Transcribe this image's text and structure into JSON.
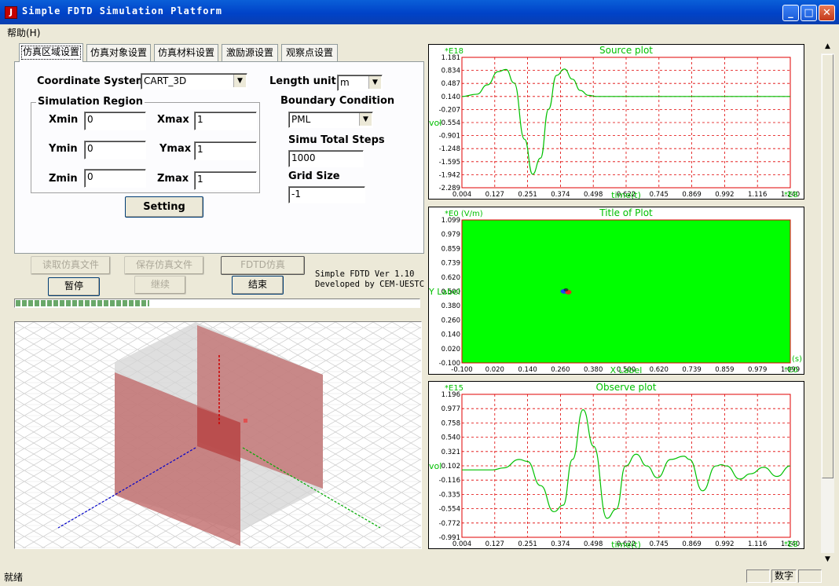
{
  "window": {
    "title": "Simple FDTD Simulation Platform"
  },
  "menu": {
    "help": "帮助(H)"
  },
  "tabs": [
    "仿真区域设置",
    "仿真对象设置",
    "仿真材料设置",
    "激励源设置",
    "观察点设置"
  ],
  "form": {
    "coord_label": "Coordinate  System",
    "coord_value": "CART_3D",
    "length_label": "Length unit",
    "length_value": "m",
    "region_title": "Simulation Region",
    "xmin_label": "Xmin",
    "xmin": "0",
    "xmax_label": "Xmax",
    "xmax": "1",
    "ymin_label": "Ymin",
    "ymin": "0",
    "ymax_label": "Ymax",
    "ymax": "1",
    "zmin_label": "Zmin",
    "zmin": "0",
    "zmax_label": "Zmax",
    "zmax": "1",
    "boundary_label": "Boundary Condition",
    "boundary_value": "PML",
    "steps_label": "Simu Total Steps",
    "steps_value": "1000",
    "grid_label": "Grid Size",
    "grid_value": "-1",
    "setting_button": "Setting"
  },
  "controls": {
    "read_file": "读取仿真文件",
    "save_file": "保存仿真文件",
    "fdtd_sim": "FDTD仿真",
    "pause": "暂停",
    "resume": "继续",
    "end": "结束",
    "version": "Simple FDTD Ver 1.10",
    "developer": "Developed by CEM-UESTC",
    "progress": 0.33
  },
  "colors": {
    "plot_green": "#00c000",
    "grid_red": "#e00000",
    "field_green": "#00ff00",
    "box": "#c06b6b"
  },
  "chart_data": [
    {
      "type": "line",
      "title": "Source plot",
      "multiplier": "*E18",
      "ylabel": "vol",
      "xlabel": "time(t)",
      "x_multiplier": "*E8",
      "ylim": [
        -2.289,
        1.181
      ],
      "yticks": [
        "1.181",
        "0.834",
        "0.487",
        "0.140",
        "-0.207",
        "-0.554",
        "-0.901",
        "-1.248",
        "-1.595",
        "-1.942",
        "-2.289"
      ],
      "xlim": [
        0.004,
        1.24
      ],
      "xticks": [
        "0.004",
        "0.127",
        "0.251",
        "0.374",
        "0.498",
        "0.622",
        "0.745",
        "0.869",
        "0.992",
        "1.116",
        "1.240"
      ],
      "series": [
        {
          "x": [
            0.004,
            0.06,
            0.1,
            0.14,
            0.17,
            0.2,
            0.24,
            0.27,
            0.3,
            0.33,
            0.36,
            0.39,
            0.42,
            0.45,
            0.48,
            0.51,
            0.56,
            0.62,
            0.8,
            1.0,
            1.24
          ],
          "values": [
            0.14,
            0.2,
            0.45,
            0.8,
            0.86,
            0.5,
            -1.0,
            -1.93,
            -1.5,
            -0.2,
            0.7,
            0.87,
            0.6,
            0.3,
            0.17,
            0.14,
            0.14,
            0.14,
            0.14,
            0.14,
            0.14
          ]
        }
      ]
    },
    {
      "type": "heatmap",
      "title": "Title of Plot",
      "multiplier": "*E0",
      "unit": "(V/m)",
      "ylabel": "Y Label",
      "xlabel": "X Label",
      "x_unit": "(s)",
      "x_multiplier": "*E0",
      "ylim": [
        -0.1,
        1.099
      ],
      "yticks": [
        "1.099",
        "0.979",
        "0.859",
        "0.739",
        "0.620",
        "0.500",
        "0.380",
        "0.260",
        "0.140",
        "0.020",
        "-0.100"
      ],
      "xlim": [
        -0.1,
        1.099
      ],
      "xticks": [
        "-0.100",
        "0.020",
        "0.140",
        "0.260",
        "0.380",
        "0.500",
        "0.620",
        "0.739",
        "0.859",
        "0.979",
        "1.099"
      ],
      "hotspot": {
        "x": 0.28,
        "y": 0.5
      }
    },
    {
      "type": "line",
      "title": "Observe plot",
      "multiplier": "*E15",
      "ylabel": "vol",
      "xlabel": "time(t)",
      "x_multiplier": "*E8",
      "ylim": [
        -0.991,
        1.196
      ],
      "yticks": [
        "1.196",
        "0.977",
        "0.758",
        "0.540",
        "0.321",
        "0.102",
        "-0.116",
        "-0.335",
        "-0.554",
        "-0.772",
        "-0.991"
      ],
      "xlim": [
        0.004,
        1.24
      ],
      "xticks": [
        "0.004",
        "0.127",
        "0.251",
        "0.374",
        "0.498",
        "0.622",
        "0.745",
        "0.869",
        "0.992",
        "1.116",
        "1.240"
      ],
      "series": [
        {
          "x": [
            0.004,
            0.12,
            0.16,
            0.22,
            0.25,
            0.3,
            0.35,
            0.385,
            0.42,
            0.46,
            0.5,
            0.55,
            0.585,
            0.62,
            0.66,
            0.7,
            0.74,
            0.79,
            0.84,
            0.86,
            0.91,
            0.96,
            0.98,
            1.0,
            1.05,
            1.09,
            1.14,
            1.19,
            1.24
          ],
          "values": [
            0.04,
            0.04,
            0.07,
            0.2,
            0.17,
            -0.2,
            -0.6,
            -0.5,
            0.2,
            0.96,
            0.4,
            -0.7,
            -0.56,
            0.1,
            0.28,
            0.1,
            -0.08,
            0.2,
            0.25,
            0.2,
            -0.28,
            0.1,
            0.12,
            0.1,
            -0.1,
            -0.02,
            0.08,
            -0.06,
            0.1
          ]
        }
      ]
    }
  ],
  "status": {
    "ready": "就绪",
    "num": "数字"
  }
}
